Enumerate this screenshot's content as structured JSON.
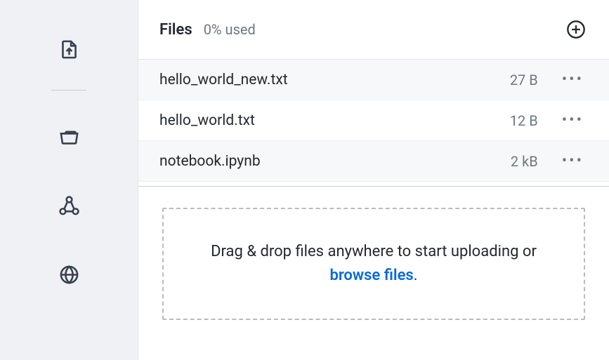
{
  "header": {
    "title": "Files",
    "usage": "0% used"
  },
  "files": [
    {
      "name": "hello_world_new.txt",
      "size": "27 B"
    },
    {
      "name": "hello_world.txt",
      "size": "12 B"
    },
    {
      "name": "notebook.ipynb",
      "size": "2 kB"
    }
  ],
  "dropzone": {
    "lead": "Drag & drop files anywhere to start uploading or ",
    "link": "browse files",
    "tail": "."
  },
  "icons": {
    "upload": "upload-file-icon",
    "folder": "folder-open-icon",
    "share": "share-nodes-icon",
    "globe": "globe-icon",
    "add": "plus-circle-icon",
    "more": "more-horizontal-icon"
  }
}
